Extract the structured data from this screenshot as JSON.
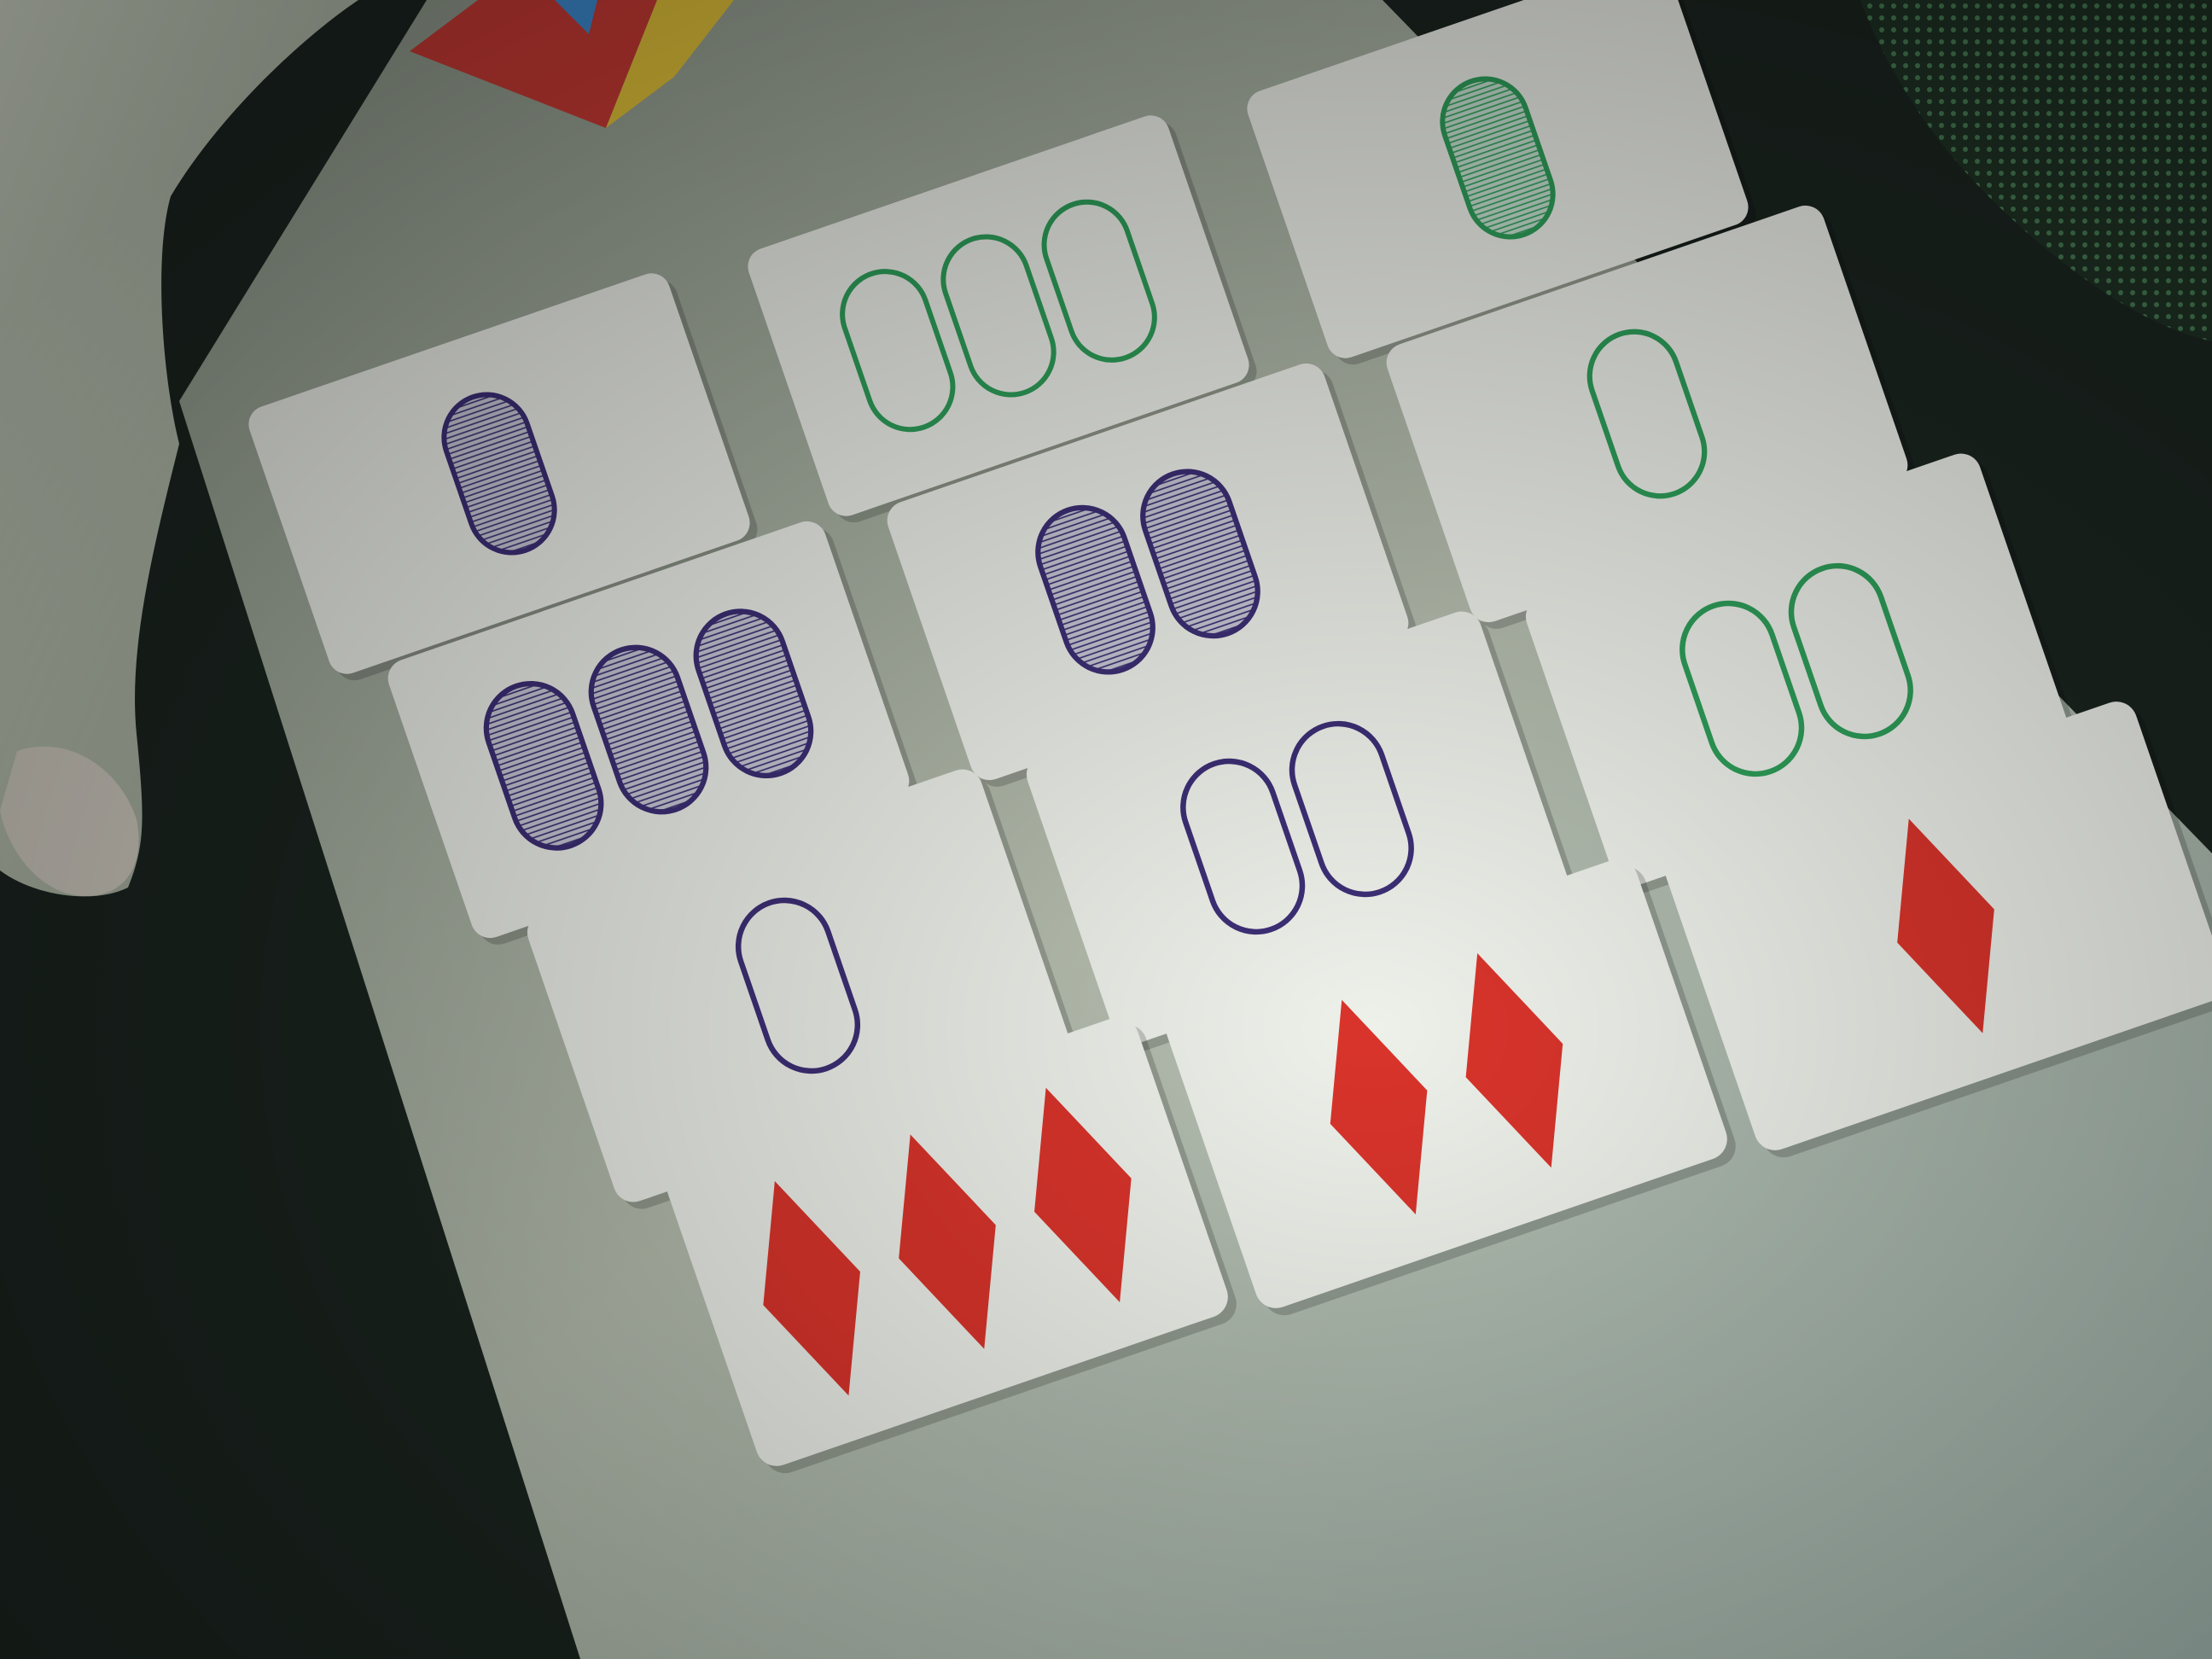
{
  "scene": {
    "table_color": "#c9c9bc",
    "card_color": "#eef0ea",
    "colors": {
      "red": "#d9342b",
      "green": "#2e9f5a",
      "purple": "#3d2f76"
    },
    "cards": [
      {
        "row": 0,
        "col": 0,
        "count": 1,
        "shape": "oval",
        "color": "purple",
        "fill": "striped"
      },
      {
        "row": 0,
        "col": 1,
        "count": 3,
        "shape": "oval",
        "color": "green",
        "fill": "outline"
      },
      {
        "row": 0,
        "col": 2,
        "count": 1,
        "shape": "oval",
        "color": "green",
        "fill": "striped"
      },
      {
        "row": 1,
        "col": 0,
        "count": 3,
        "shape": "oval",
        "color": "purple",
        "fill": "striped"
      },
      {
        "row": 1,
        "col": 1,
        "count": 2,
        "shape": "oval",
        "color": "purple",
        "fill": "striped"
      },
      {
        "row": 1,
        "col": 2,
        "count": 1,
        "shape": "oval",
        "color": "green",
        "fill": "outline"
      },
      {
        "row": 2,
        "col": 0,
        "count": 1,
        "shape": "oval",
        "color": "purple",
        "fill": "outline"
      },
      {
        "row": 2,
        "col": 1,
        "count": 2,
        "shape": "oval",
        "color": "purple",
        "fill": "outline"
      },
      {
        "row": 2,
        "col": 2,
        "count": 2,
        "shape": "oval",
        "color": "green",
        "fill": "outline"
      },
      {
        "row": 3,
        "col": 0,
        "count": 3,
        "shape": "diamond",
        "color": "red",
        "fill": "solid"
      },
      {
        "row": 3,
        "col": 1,
        "count": 2,
        "shape": "diamond",
        "color": "red",
        "fill": "solid"
      },
      {
        "row": 3,
        "col": 2,
        "count": 1,
        "shape": "diamond",
        "color": "red",
        "fill": "solid"
      }
    ]
  }
}
